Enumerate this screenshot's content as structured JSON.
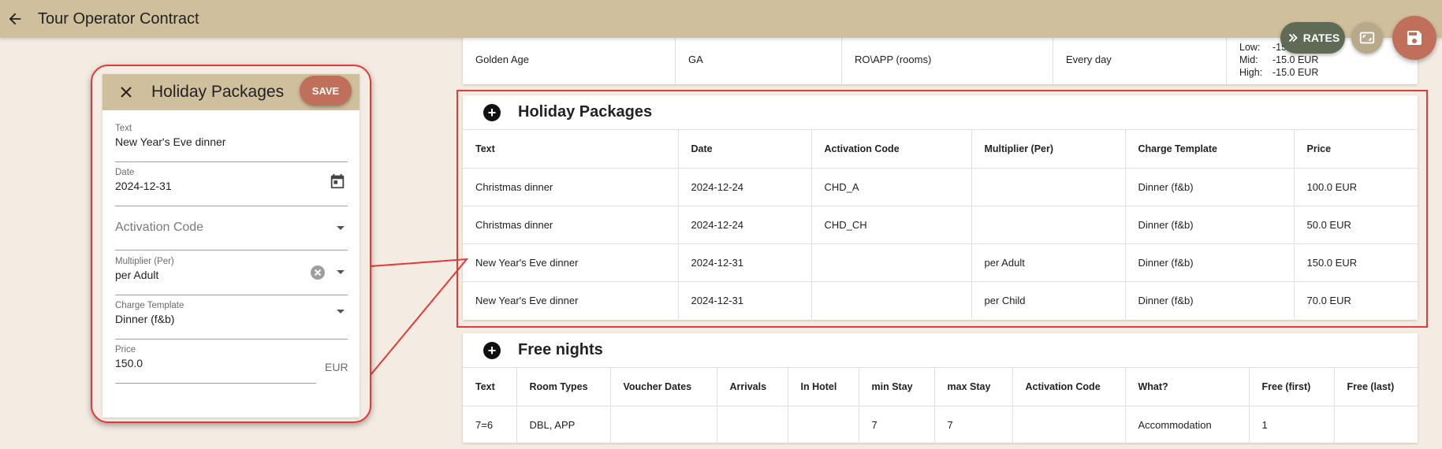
{
  "app": {
    "title": "Tour Operator Contract"
  },
  "fabs": {
    "rates_label": "RATES"
  },
  "previous_row": {
    "cells": [
      "Golden Age",
      "GA",
      "RO\\APP (rooms)",
      "Every day"
    ],
    "seasons": [
      {
        "label": "Low:",
        "value": "-15.0 EUR"
      },
      {
        "label": "Mid:",
        "value": "-15.0 EUR"
      },
      {
        "label": "High:",
        "value": "-15.0 EUR"
      }
    ]
  },
  "holiday_packages": {
    "title": "Holiday Packages",
    "columns": [
      "Text",
      "Date",
      "Activation Code",
      "Multiplier (Per)",
      "Charge Template",
      "Price"
    ],
    "rows": [
      [
        "Christmas dinner",
        "2024-12-24",
        "CHD_A",
        "",
        "Dinner (f&b)",
        "100.0 EUR"
      ],
      [
        "Christmas dinner",
        "2024-12-24",
        "CHD_CH",
        "",
        "Dinner (f&b)",
        "50.0 EUR"
      ],
      [
        "New Year's Eve dinner",
        "2024-12-31",
        "",
        "per Adult",
        "Dinner (f&b)",
        "150.0 EUR"
      ],
      [
        "New Year's Eve dinner",
        "2024-12-31",
        "",
        "per Child",
        "Dinner (f&b)",
        "70.0 EUR"
      ]
    ]
  },
  "free_nights": {
    "title": "Free nights",
    "columns": [
      "Text",
      "Room Types",
      "Voucher Dates",
      "Arrivals",
      "In Hotel",
      "min Stay",
      "max Stay",
      "Activation Code",
      "What?",
      "Free (first)",
      "Free (last)"
    ],
    "rows": [
      [
        "7=6",
        "DBL, APP",
        "",
        "",
        "",
        "7",
        "7",
        "",
        "Accommodation",
        "1",
        ""
      ]
    ]
  },
  "dialog": {
    "title": "Holiday Packages",
    "save_label": "SAVE",
    "text": {
      "label": "Text",
      "value": "New Year's Eve dinner"
    },
    "date": {
      "label": "Date",
      "value": "2024-12-31"
    },
    "activation_code": {
      "placeholder": "Activation Code"
    },
    "multiplier": {
      "label": "Multiplier (Per)",
      "value": "per Adult"
    },
    "charge_template": {
      "label": "Charge Template",
      "value": "Dinner (f&b)"
    },
    "price": {
      "label": "Price",
      "value": "150.0",
      "suffix": "EUR"
    }
  }
}
